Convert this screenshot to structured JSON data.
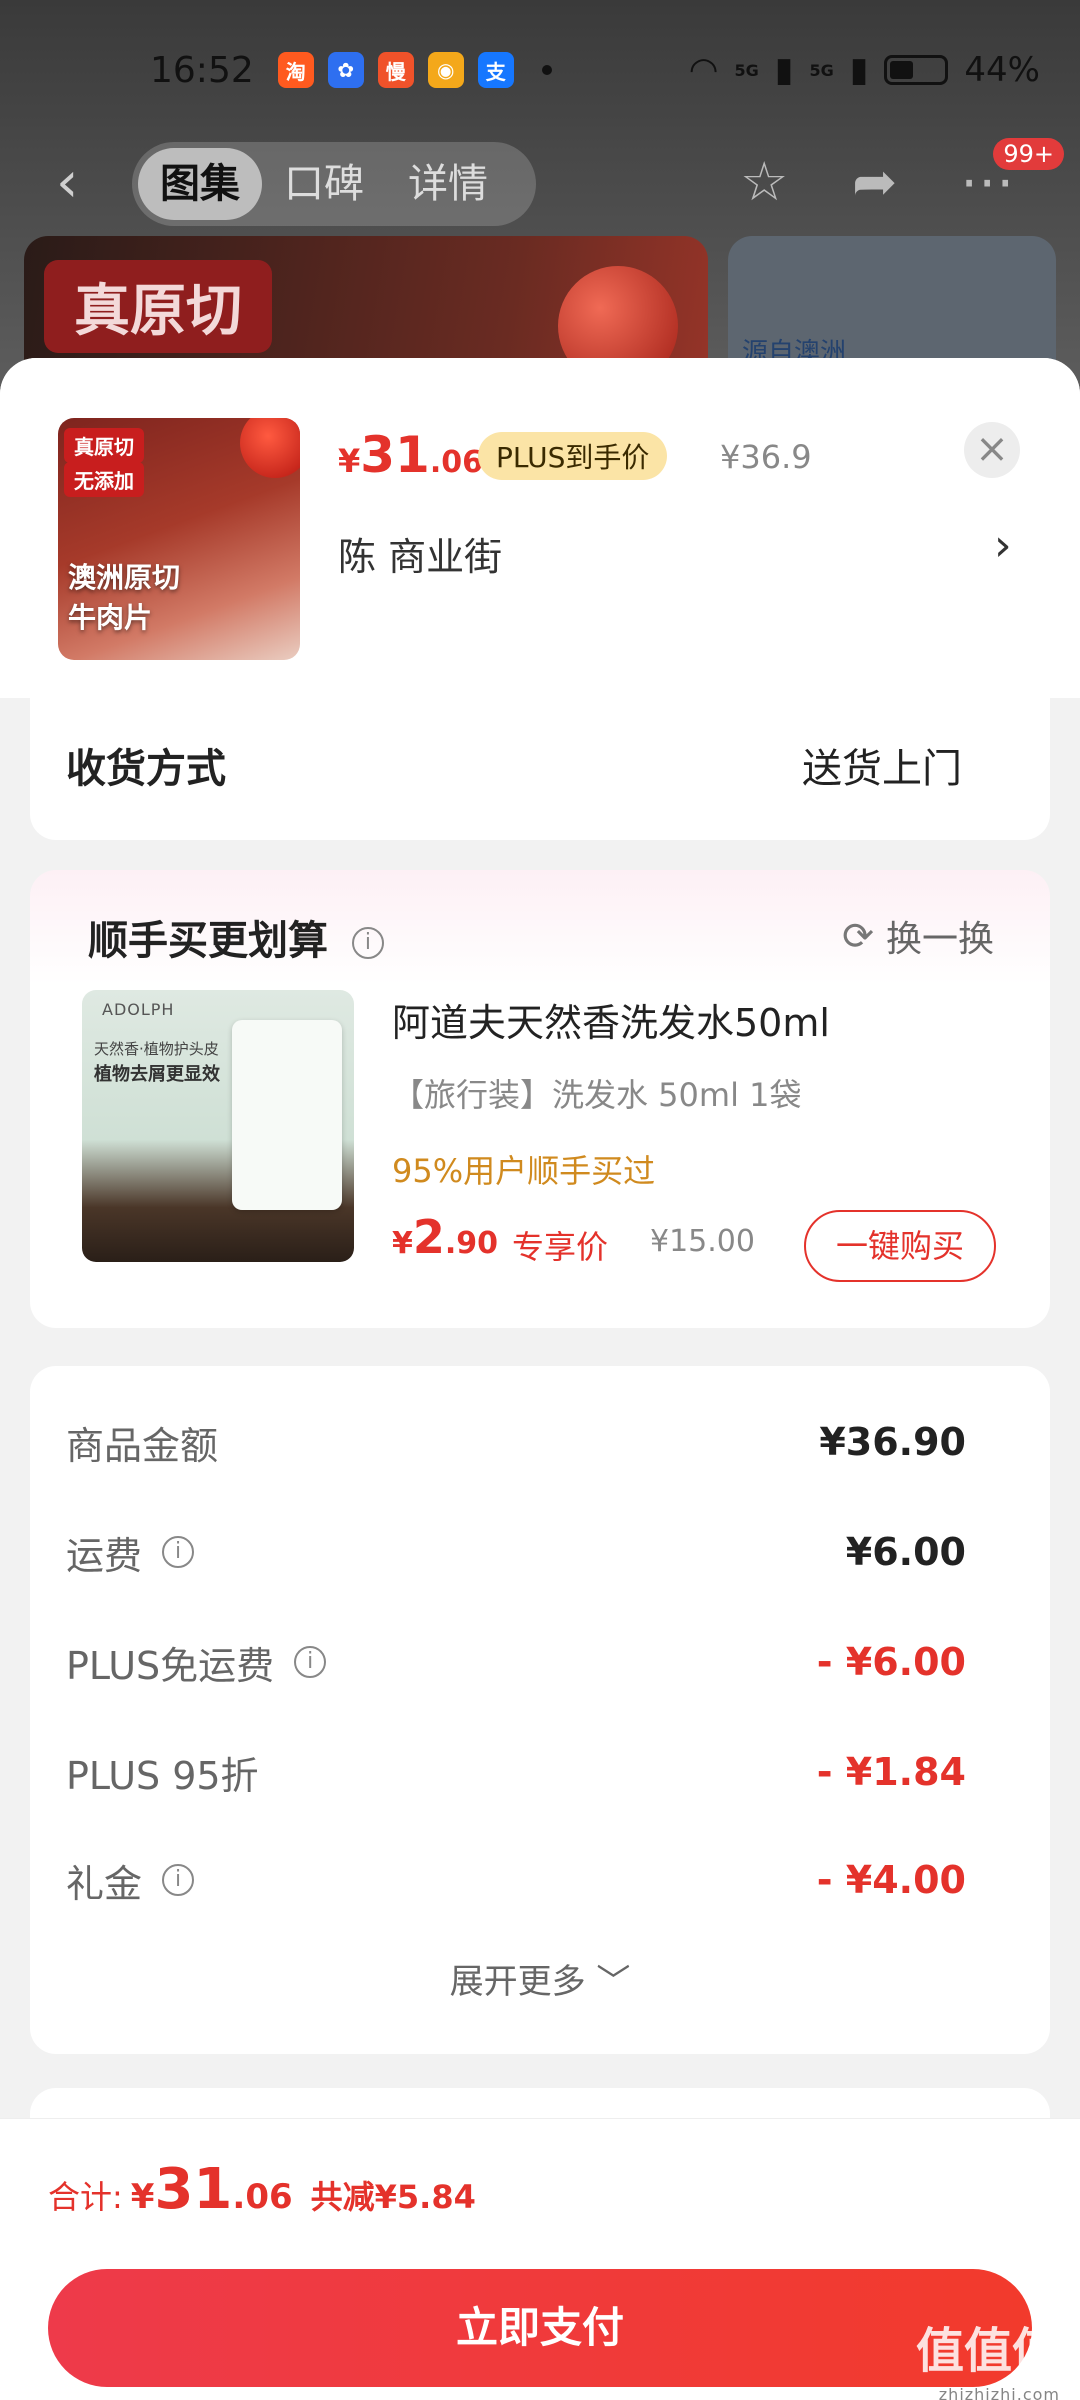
{
  "status_bar": {
    "time": "16:52",
    "app_icons": [
      {
        "name": "taobao-icon",
        "glyph": "淘",
        "color": "#ff5a1f"
      },
      {
        "name": "baidu-icon",
        "glyph": "✿",
        "color": "#2e6ff0"
      },
      {
        "name": "manhua-icon",
        "glyph": "慢",
        "color": "#f0522a"
      },
      {
        "name": "weibo-icon",
        "glyph": "◉",
        "color": "#f4a81a"
      },
      {
        "name": "alipay-icon",
        "glyph": "支",
        "color": "#1677ff"
      }
    ],
    "signal_label": "5G",
    "battery": "44%",
    "battery_level": 0.44
  },
  "nav": {
    "tabs": [
      {
        "label": "图集",
        "active": true
      },
      {
        "label": "口碑",
        "active": false
      },
      {
        "label": "详情",
        "active": false
      }
    ],
    "badge": "99+"
  },
  "background": {
    "banner_tag": "真原切",
    "side_text": "源自澳洲"
  },
  "product": {
    "thumb_tags": [
      "真原切",
      "无添加"
    ],
    "thumb_title_lines": [
      "澳洲原切",
      "牛肉片"
    ],
    "currency": "¥",
    "price_int": "31",
    "price_dec": ".06",
    "plus_tag": "PLUS到手价",
    "original_price": "¥36.9",
    "seller": "陈  商业街"
  },
  "shipping": {
    "label": "收货方式",
    "value": "送货上门"
  },
  "addon": {
    "title": "顺手买更划算",
    "refresh_label": "换一换",
    "image_brand": "ADOLPH",
    "image_text_1": "天然香·植物护头皮",
    "image_text_2": "植物去屑更显效",
    "name": "阿道夫天然香洗发水50ml",
    "spec": "【旅行装】洗发水 50ml 1袋",
    "stat": "95%用户顺手买过",
    "currency": "¥",
    "price_int": "2",
    "price_dec": ".90",
    "exclusive_label": "专享价",
    "original_price": "¥15.00",
    "buy_label": "一键购买"
  },
  "summary": {
    "rows": [
      {
        "label": "商品金额",
        "value": "¥36.90",
        "info": false,
        "red": false
      },
      {
        "label": "运费",
        "value": "¥6.00",
        "info": true,
        "red": false
      },
      {
        "label": "PLUS免运费",
        "value": "- ¥6.00",
        "info": true,
        "red": true
      },
      {
        "label": "PLUS 95折",
        "value": "- ¥1.84",
        "info": false,
        "red": true
      },
      {
        "label": "礼金",
        "value": "- ¥4.00",
        "info": true,
        "red": true
      }
    ],
    "expand_label": "展开更多"
  },
  "bottom": {
    "total_label": "合计:",
    "currency": "¥",
    "total_int": "31",
    "total_dec": ".06",
    "saved": "共减¥5.84",
    "pay_label": "立即支付",
    "watermark": "值值值",
    "watermark_sub": "zhizhizhi.com"
  },
  "colors": {
    "accent_red": "#e4322b",
    "plus_gold": "#fbe4a6",
    "stat_orange": "#d08a1e"
  }
}
